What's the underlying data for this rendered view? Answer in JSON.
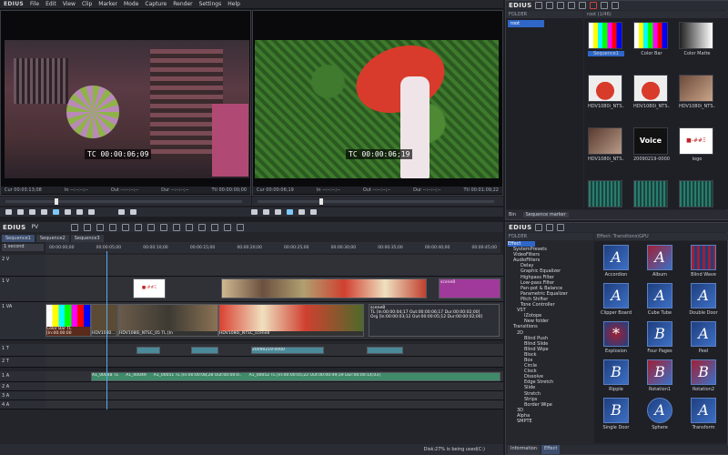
{
  "app": {
    "logo": "EDIUS",
    "menu": [
      "File",
      "Edit",
      "View",
      "Clip",
      "Marker",
      "Mode",
      "Capture",
      "Render",
      "Settings",
      "Help"
    ]
  },
  "player": {
    "timecode": "00:00:06;09",
    "in": "In",
    "out": "Out",
    "dur": "Dur",
    "ttl": "Ttl",
    "cur": "Cur 00:03:13;08",
    "in_v": "--:--:--;--",
    "out_v": "--:--:--;--",
    "dur_v": "--:--:--;--",
    "ttl_v": "00:00:00;00"
  },
  "recorder": {
    "timecode": "00:00:06;19",
    "cur": "Cur 00:00:06;19",
    "in": "In",
    "in_v": "--:--:--;--",
    "out": "Out",
    "out_v": "--:--:--;--",
    "dur": "Dur",
    "dur_v": "--:--:--;--",
    "ttl": "Ttl",
    "ttl_v": "00:01:09;22"
  },
  "bin": {
    "logo": "EDIUS",
    "folder_header": "FOLDER",
    "root": "root",
    "path": "root (1/46)",
    "thumbs": [
      "Sequence1",
      "Color Bar",
      "Color Matte",
      "HDV1080i_NTS...",
      "HDV1080i_NTS...",
      "HDV1080i_NTS...",
      "HDV1080i_NTS...",
      "20090219-0000",
      "logo",
      "",
      "",
      ""
    ],
    "thumb_tcs": [
      "00:00:00;00",
      "00:00:00;00",
      "00:00:00;00",
      "00:00:00;00",
      "00:00:00;00",
      "00:00:00;00",
      "00:00:00;00",
      "",
      "00:00:00;00"
    ],
    "footer": "Sequence marker",
    "footer_left": "Bin"
  },
  "timeline": {
    "logo": "EDIUS",
    "mode": "PV",
    "tabs": [
      "Sequence1",
      "Sequence2",
      "Sequence3"
    ],
    "scale": "1 second",
    "ruler": [
      "00:00:00;00",
      "00:00:05;00",
      "00:00:10;00",
      "00:00:15;00",
      "00:00:20;00",
      "00:00:25;00",
      "00:00:30;00",
      "00:00:35;00",
      "00:00:40;00",
      "00:00:45;00"
    ],
    "tracks": [
      "2 V",
      "1 V",
      "1 VA",
      "1 T",
      "2 T",
      "1 A",
      "2 A",
      "3 A",
      "4 A"
    ],
    "status": "Disk:27% is being used(C:)"
  },
  "clips": {
    "scene8": "scene8",
    "scene8_tl": "TL [In:00:00:04;17 Out:00:00:06;17 Dur:00:00:02;00]",
    "scene8_org": "Org [In:00:00:03;12 Out:00:00:05;12 Dur:00:00:02;00]",
    "colorbar": "Color Bar TL [In:00:00:00",
    "hdv1": "HDV1080...",
    "hdv2": "HDV1080i_NTSC_05 TL [In",
    "hdv3": "HDV1080i_NTSC_scene8",
    "ttl": "20090219-0000",
    "a1": "A1_00048 TL",
    "a2": "A1_00049",
    "a3": "A1_00051 TL [In:00:00:08;28 Out:00:00:0..",
    "a4": "A1_00052 TL [In:00:00:05;22 Out:00:00:49;19 Dur:00:00:14;03]",
    "a5": "A1_00048 TL [In:00:00:00"
  },
  "effects": {
    "logo": "EDIUS",
    "header_left": "FOLDER",
    "header_right": "Effect: Transitions\\GPU",
    "tree": [
      "Effect",
      "SystemPresets",
      "VideoFilters",
      "AudioFilters",
      "Delay",
      "Graphic Equalizer",
      "Highpass Filter",
      "Low-pass Filter",
      "Pan-pot & Balance",
      "Parametric Equalizer",
      "Pitch Shifter",
      "Tone Controller",
      "VST",
      "IZotope",
      "New folder",
      "Transitions",
      "2D",
      "Blind Push",
      "Blind Slide",
      "Blind Wipe",
      "Block",
      "Box",
      "Circle",
      "Clock",
      "Dissolve",
      "Edge Stretch",
      "Slide",
      "Stretch",
      "Strips",
      "Border Wipe",
      "3D",
      "Alpha",
      "SMPTE"
    ],
    "items": [
      "Accordion",
      "Album",
      "Blind Wave",
      "Clipper Board",
      "Cube Tube",
      "Double Door",
      "Explosion",
      "Four Pages",
      "Peel",
      "Ripple",
      "Rotation1",
      "Rotation2",
      "Single Door",
      "Sphere",
      "Transform"
    ],
    "tabs": [
      "Information",
      "Effect"
    ]
  }
}
